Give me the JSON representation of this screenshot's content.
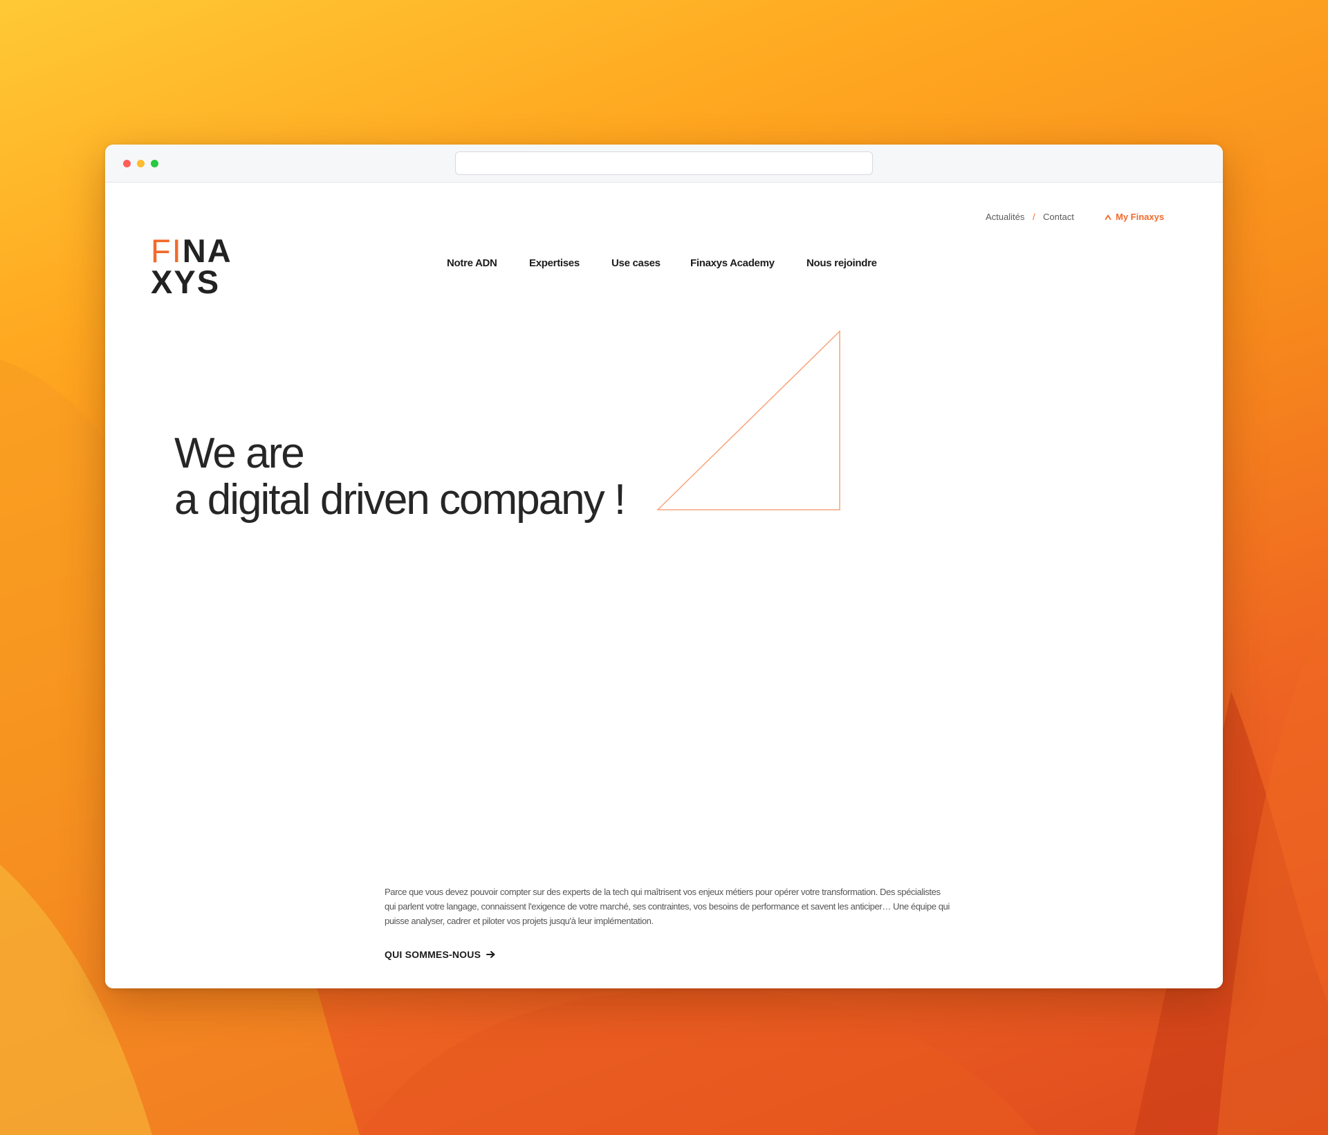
{
  "colors": {
    "accent": "#f26a2a",
    "text_dark": "#1c1c1c",
    "wallpaper_top": "#ffc935",
    "wallpaper_bottom": "#de4a1e"
  },
  "browser": {
    "url": ""
  },
  "top_links": {
    "news": "Actualités",
    "separator": "/",
    "contact": "Contact",
    "my_finaxys": "My Finaxys",
    "my_finaxys_icon": "chevron-up-icon"
  },
  "logo": {
    "line1_orange": "FI",
    "line1_dark": "NA",
    "line2_dark": "XYS"
  },
  "nav": {
    "adn": "Notre ADN",
    "expertises": "Expertises",
    "use_cases": "Use cases",
    "academy": "Finaxys Academy",
    "join": "Nous rejoindre"
  },
  "hero": {
    "line1": "We are",
    "line2": "a digital driven company !"
  },
  "intro": {
    "text": "Parce que vous devez pouvoir compter sur des experts de la tech qui maîtrisent vos enjeux métiers pour opérer votre transformation. Des spécialistes qui parlent votre langage, connaissent l'exigence de votre marché, ses contraintes, vos besoins de performance et savent les anticiper… Une équipe qui puisse analyser, cadrer et piloter vos projets jusqu'à leur implémentation.",
    "cta": "QUI SOMMES-NOUS",
    "cta_icon": "arrow-right-icon"
  }
}
